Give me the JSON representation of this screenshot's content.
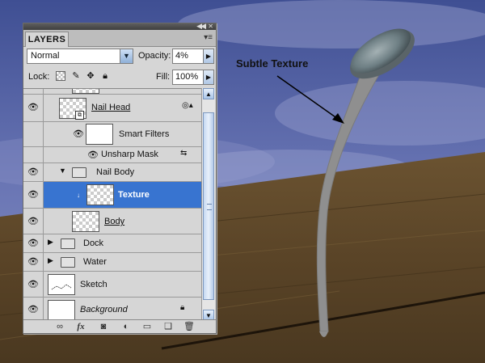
{
  "callout": {
    "text": "Subtle Texture"
  },
  "panel": {
    "tab": "LAYERS",
    "blend_mode": "Normal",
    "opacity_label": "Opacity:",
    "opacity_value": "4%",
    "lock_label": "Lock:",
    "fill_label": "Fill:",
    "fill_value": "100%",
    "layers": [
      {
        "name": "Nail Head"
      },
      {
        "name": "Smart Filters"
      },
      {
        "name": "Unsharp Mask"
      },
      {
        "name": "Nail Body"
      },
      {
        "name": "Texture"
      },
      {
        "name": "Body"
      },
      {
        "name": "Dock"
      },
      {
        "name": "Water"
      },
      {
        "name": "Sketch"
      },
      {
        "name": "Background"
      }
    ],
    "bottom_icons": [
      "link-icon",
      "fx-icon",
      "mask-icon",
      "adjustment-icon",
      "folder-icon",
      "new-layer-icon",
      "trash-icon"
    ],
    "fx_label": "fx"
  },
  "colors": {
    "selection": "#3874d0"
  }
}
